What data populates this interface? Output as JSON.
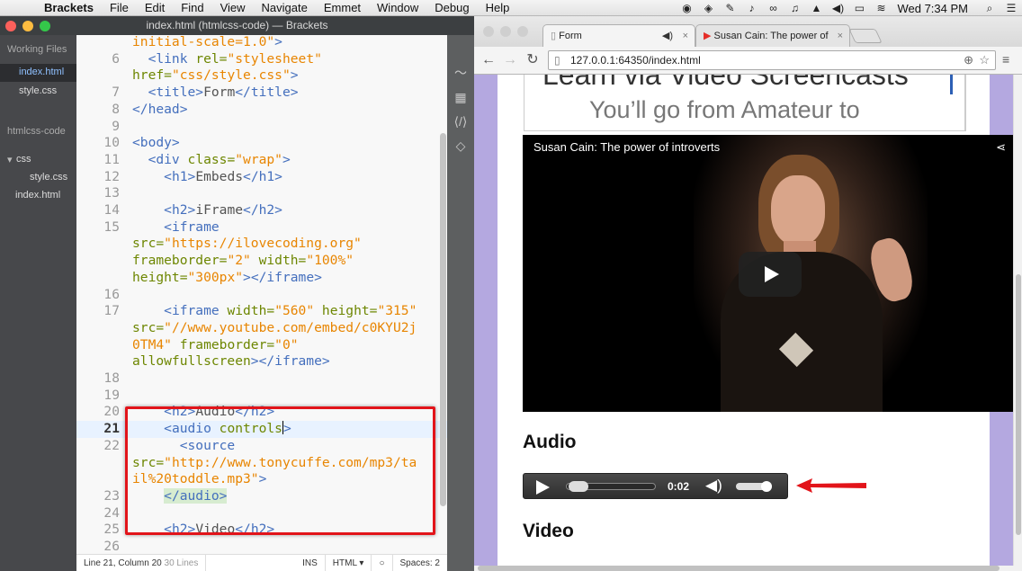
{
  "menubar": {
    "app_name": "Brackets",
    "items": [
      "File",
      "Edit",
      "Find",
      "View",
      "Navigate",
      "Emmet",
      "Window",
      "Debug",
      "Help"
    ],
    "clock": "Wed 7:34 PM"
  },
  "brackets": {
    "title": "index.html (htmlcss-code) — Brackets",
    "sidebar": {
      "working_files_label": "Working Files",
      "working_files": [
        "index.html",
        "style.css"
      ],
      "project_label": "htmlcss-code",
      "folder": "css",
      "folder_files": [
        "style.css"
      ],
      "root_files": [
        "index.html"
      ]
    },
    "code_lines": [
      {
        "num": "",
        "html": "<span class='s'>initial-scale=1.0\"</span><span class='t'>&gt;</span>"
      },
      {
        "num": "6",
        "html": "  <span class='t'>&lt;link</span> <span class='a'>rel=</span><span class='s'>\"stylesheet\"</span>"
      },
      {
        "num": "",
        "html": "<span class='a'>href=</span><span class='s'>\"css/style.css\"</span><span class='t'>&gt;</span>"
      },
      {
        "num": "7",
        "html": "  <span class='t'>&lt;title&gt;</span><span class='tx'>Form</span><span class='t'>&lt;/title&gt;</span>"
      },
      {
        "num": "8",
        "html": "<span class='t'>&lt;/head&gt;</span>"
      },
      {
        "num": "9",
        "html": ""
      },
      {
        "num": "10",
        "html": "<span class='t'>&lt;body&gt;</span>"
      },
      {
        "num": "11",
        "html": "  <span class='t'>&lt;div</span> <span class='a'>class=</span><span class='s'>\"wrap\"</span><span class='t'>&gt;</span>"
      },
      {
        "num": "12",
        "html": "    <span class='t'>&lt;h1&gt;</span><span class='tx'>Embeds</span><span class='t'>&lt;/h1&gt;</span>"
      },
      {
        "num": "13",
        "html": ""
      },
      {
        "num": "14",
        "html": "    <span class='t'>&lt;h2&gt;</span><span class='tx'>iFrame</span><span class='t'>&lt;/h2&gt;</span>"
      },
      {
        "num": "15",
        "html": "    <span class='t'>&lt;iframe</span>"
      },
      {
        "num": "",
        "html": "<span class='a'>src=</span><span class='s'>\"https://ilovecoding.org\"</span>"
      },
      {
        "num": "",
        "html": "<span class='a'>frameborder=</span><span class='s'>\"2\"</span> <span class='a'>width=</span><span class='s'>\"100%\"</span>"
      },
      {
        "num": "",
        "html": "<span class='a'>height=</span><span class='s'>\"300px\"</span><span class='t'>&gt;&lt;/iframe&gt;</span>"
      },
      {
        "num": "16",
        "html": ""
      },
      {
        "num": "17",
        "html": "    <span class='t'>&lt;iframe</span> <span class='a'>width=</span><span class='s'>\"560\"</span> <span class='a'>height=</span><span class='s'>\"315\"</span>"
      },
      {
        "num": "",
        "html": "<span class='a'>src=</span><span class='s'>\"//www.youtube.com/embed/c0KYU2j</span>"
      },
      {
        "num": "",
        "html": "<span class='s'>0TM4\"</span> <span class='a'>frameborder=</span><span class='s'>\"0\"</span>"
      },
      {
        "num": "",
        "html": "<span class='a'>allowfullscreen</span><span class='t'>&gt;&lt;/iframe&gt;</span>"
      },
      {
        "num": "18",
        "html": ""
      },
      {
        "num": "19",
        "html": ""
      },
      {
        "num": "20",
        "html": "    <span class='t'>&lt;h2&gt;</span><span class='tx'>Audio</span><span class='t'>&lt;/h2&gt;</span>"
      },
      {
        "num": "21",
        "html": "    <span class='t'>&lt;audio</span> <span class='a'>controls</span><span class='cursor'></span><span class='t'>&gt;</span>",
        "active": true
      },
      {
        "num": "22",
        "html": "      <span class='t'>&lt;source</span>"
      },
      {
        "num": "",
        "html": "<span class='a'>src=</span><span class='s'>\"http://www.tonycuffe.com/mp3/ta</span>"
      },
      {
        "num": "",
        "html": "<span class='s'>il%20toddle.mp3\"</span><span class='t'>&gt;</span>"
      },
      {
        "num": "23",
        "html": "    <span class='t' style='background:#d7ecd0'>&lt;/audio&gt;</span>"
      },
      {
        "num": "24",
        "html": ""
      },
      {
        "num": "25",
        "html": "    <span class='t'>&lt;h2&gt;</span><span class='tx'>Video</span><span class='t'>&lt;/h2&gt;</span>"
      },
      {
        "num": "26",
        "html": ""
      }
    ],
    "status": {
      "cursor": "Line 21, Column 20",
      "lines": "30 Lines",
      "mode": "INS",
      "language": "HTML",
      "spaces": "Spaces: 2"
    }
  },
  "chrome": {
    "tabs": [
      {
        "label": "Form"
      },
      {
        "label": "Susan Cain: The power of"
      }
    ],
    "url": "127.0.0.1:64350/index.html",
    "page": {
      "embed_heading": "Learn via Video Screencasts",
      "embed_sub": "You’ll go from Amateur to",
      "video_title": "Susan Cain: The power of introverts",
      "audio_heading": "Audio",
      "audio_time": "0:02",
      "audio_progress": 0.05,
      "audio_volume": 0.85,
      "video_heading": "Video"
    }
  }
}
